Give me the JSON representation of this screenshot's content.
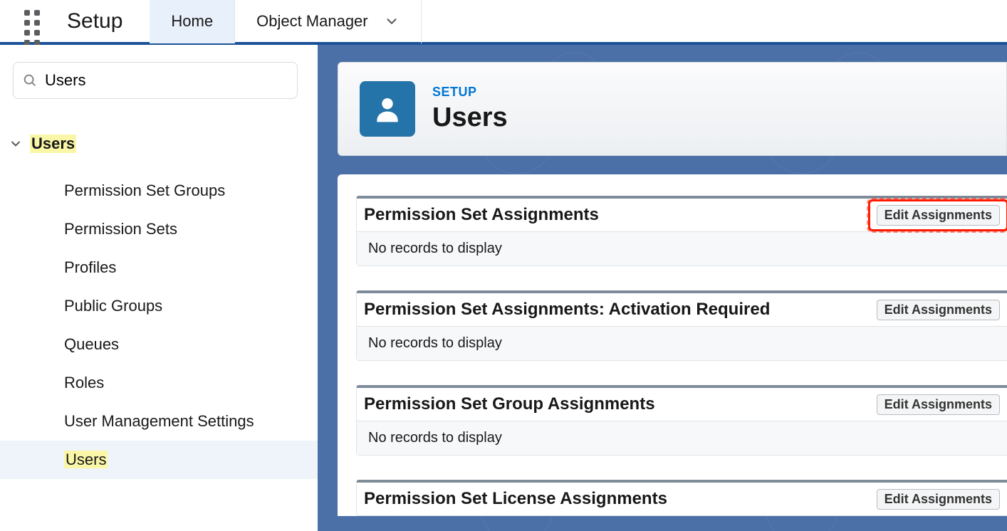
{
  "topbar": {
    "app_title": "Setup",
    "tabs": [
      {
        "label": "Home",
        "active": true
      },
      {
        "label": "Object Manager",
        "active": false
      }
    ]
  },
  "sidebar": {
    "search_value": "Users",
    "tree": {
      "parent_label": "Users",
      "children": [
        {
          "label": "Permission Set Groups",
          "active": false,
          "highlight": false
        },
        {
          "label": "Permission Sets",
          "active": false,
          "highlight": false
        },
        {
          "label": "Profiles",
          "active": false,
          "highlight": false
        },
        {
          "label": "Public Groups",
          "active": false,
          "highlight": false
        },
        {
          "label": "Queues",
          "active": false,
          "highlight": false
        },
        {
          "label": "Roles",
          "active": false,
          "highlight": false
        },
        {
          "label": "User Management Settings",
          "active": false,
          "highlight": false
        },
        {
          "label": "Users",
          "active": true,
          "highlight": true
        }
      ]
    }
  },
  "header": {
    "eyebrow": "SETUP",
    "title": "Users"
  },
  "panels": [
    {
      "title": "Permission Set Assignments",
      "button": "Edit Assignments",
      "body": "No records to display",
      "highlight_button": true
    },
    {
      "title": "Permission Set Assignments: Activation Required",
      "button": "Edit Assignments",
      "body": "No records to display",
      "highlight_button": false
    },
    {
      "title": "Permission Set Group Assignments",
      "button": "Edit Assignments",
      "body": "No records to display",
      "highlight_button": false
    },
    {
      "title": "Permission Set License Assignments",
      "button": "Edit Assignments",
      "body": "",
      "highlight_button": false
    }
  ]
}
